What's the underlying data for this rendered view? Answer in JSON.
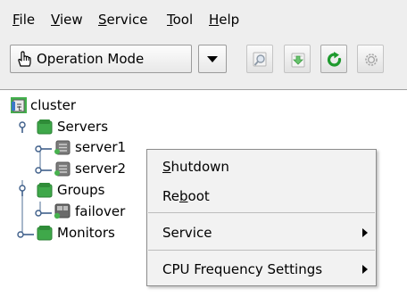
{
  "menubar": {
    "items": [
      {
        "label": "File",
        "mnemonic": "F",
        "rest": "ile"
      },
      {
        "label": "View",
        "mnemonic": "V",
        "rest": "iew"
      },
      {
        "label": "Service",
        "mnemonic": "S",
        "rest": "ervice"
      },
      {
        "label": "Tool",
        "mnemonic": "T",
        "rest": "ool"
      },
      {
        "label": "Help",
        "mnemonic": "H",
        "rest": "elp"
      }
    ]
  },
  "toolbar": {
    "mode": {
      "value": "Operation Mode",
      "icon": "hand-pointer-icon"
    },
    "buttons": [
      {
        "icon": "search-icon",
        "enabled": false
      },
      {
        "icon": "download-icon",
        "enabled": false
      },
      {
        "icon": "refresh-icon",
        "enabled": true
      },
      {
        "icon": "gear-icon",
        "enabled": false
      }
    ]
  },
  "tree": {
    "root": {
      "label": "cluster",
      "icon": "cluster-icon"
    },
    "nodes": {
      "servers": {
        "label": "Servers",
        "icon": "folder-green-icon",
        "expanded": true
      },
      "server1": {
        "label": "server1",
        "icon": "server-icon"
      },
      "server2": {
        "label": "server2",
        "icon": "server-icon"
      },
      "groups": {
        "label": "Groups",
        "icon": "folder-green-icon",
        "expanded": true
      },
      "failover": {
        "label": "failover",
        "icon": "group-icon"
      },
      "monitors": {
        "label": "Monitors",
        "icon": "folder-green-icon",
        "expanded": false
      }
    }
  },
  "context_menu": {
    "items": [
      {
        "label": "Shutdown",
        "before": "",
        "mnemonic": "S",
        "after": "hutdown",
        "submenu": false
      },
      {
        "label": "Reboot",
        "before": "Re",
        "mnemonic": "b",
        "after": "oot",
        "submenu": false
      },
      {
        "label": "Service",
        "before": "",
        "mnemonic": "",
        "after": "Service",
        "submenu": true
      },
      {
        "label": "CPU Frequency Settings",
        "before": "",
        "mnemonic": "",
        "after": "CPU Frequency Settings",
        "submenu": true
      }
    ]
  },
  "colors": {
    "toolbar_bg": "#eeeeee",
    "menu_bg": "#f2f2f2",
    "folder_green": "#3fa84a",
    "refresh_green": "#1e9a2e"
  }
}
